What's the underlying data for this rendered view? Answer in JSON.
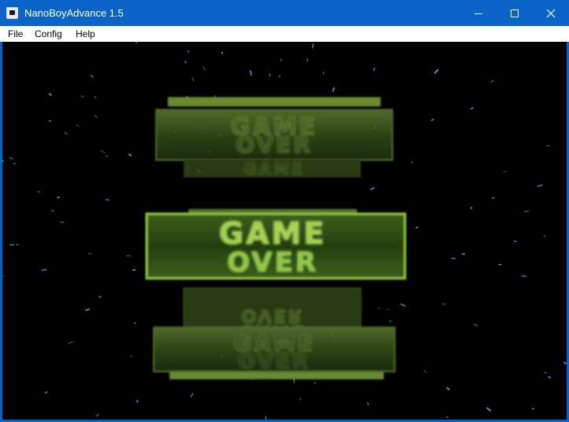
{
  "window": {
    "title": "NanoBoyAdvance 1.5",
    "controls": {
      "minimize": "minimize",
      "maximize": "maximize",
      "close": "close"
    }
  },
  "menu": {
    "file": "File",
    "config": "Config",
    "help": "Help"
  },
  "game": {
    "line1": "GAME",
    "line2": "OVER",
    "text_color": "#8ec63f",
    "panel_color": "#3f5a1e",
    "background": "#000000",
    "star_color": "#5aa6e8"
  }
}
